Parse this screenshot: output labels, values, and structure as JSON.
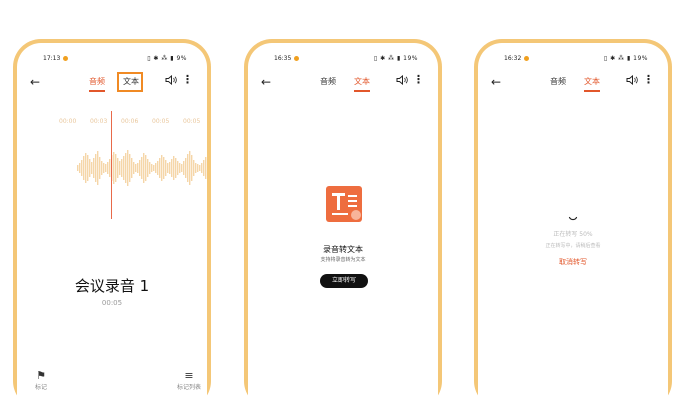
{
  "phones": [
    {
      "status": {
        "time": "17:13",
        "battery": "9%"
      },
      "tabs": {
        "audio": "音频",
        "text": "文本",
        "active": "audio"
      },
      "ticks": [
        "00:00",
        "00:03",
        "00:06",
        "00:05",
        "00:05"
      ],
      "recording_title": "会议录音 1",
      "recording_time": "00:05",
      "bottom_left_label": "标记",
      "bottom_right_label": "标记列表"
    },
    {
      "status": {
        "time": "16:35",
        "battery": "19%"
      },
      "tabs": {
        "audio": "音频",
        "text": "文本",
        "active": "text"
      },
      "convert_title": "录音转文本",
      "convert_subtitle": "支持将录音转为文本",
      "convert_button": "立即转写"
    },
    {
      "status": {
        "time": "16:32",
        "battery": "19%"
      },
      "tabs": {
        "audio": "音频",
        "text": "文本",
        "active": "text"
      },
      "progress_text": "正在转写 50%",
      "progress_note": "正在转写中，请稍后查看",
      "cancel_label": "取消转写"
    }
  ],
  "colors": {
    "accent": "#e2572b",
    "frame": "#f4c777",
    "wave": "#f5d6a8",
    "highlight": "#f08a24"
  },
  "icons": {
    "back": "←",
    "menu": "⋮",
    "flag": "⚑",
    "list": "≡"
  }
}
